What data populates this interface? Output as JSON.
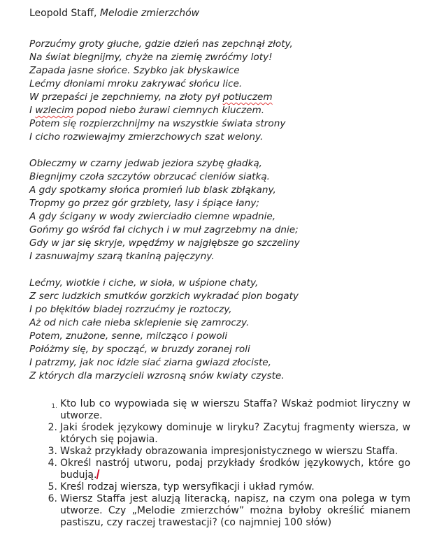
{
  "header": {
    "author": "Leopold Staff,",
    "title": "Melodie zmierzchów"
  },
  "poem": {
    "stanzas": [
      [
        "Porzućmy groty głuche, gdzie dzień nas zepchnął złoty,",
        "Na świat biegnijmy, chyże na ziemię zwróćmy loty!",
        "Zapada jasne słońce. Szybko jak błyskawice",
        "Lećmy dłoniami mroku zakrywać słońcu lice.",
        "W przepaści je zepchniemy, na złoty pył ",
        "I ",
        "Potem się rozpierzchnijmy na wszystkie świata strony",
        "I cicho rozwiewajmy zmierzchowych szat welony."
      ],
      [
        "Obleczmy w czarny jedwab jeziora szybę gładką,",
        "Biegnijmy czoła szczytów obrzucać cieniów siatką.",
        "A gdy spotkamy słońca promień lub blask zbłąkany,",
        "Tropmy go przez gór grzbiety, lasy i śpiące łany;",
        "A gdy ścigany w wody zwierciadło ciemne wpadnie,",
        "Gońmy go wśród fal cichych i w muł zagrzebmy na dnie;",
        "Gdy w jar się skryje, wpędźmy w najgłębsze go szczeliny",
        "I zasnuwajmy szarą tkaniną pajęczyny."
      ],
      [
        "Lećmy, wiotkie i ciche, w sioła, w uśpione chaty,",
        "Z serc ludzkich smutków gorzkich wykradać plon bogaty",
        "I po błękitów bladej rozrzućmy je roztoczy,",
        "Aż od nich całe nieba sklepienie się zamroczy.",
        "Potem, znużone, senne, milcząco i powoli",
        "Połóżmy się, by spocząć, w bruzdy zoranej roli",
        "I patrzmy, jak noc idzie siać ziarna gwiazd złociste,",
        "Z których dla marzycieli wzrosną snów kwiaty czyste."
      ]
    ],
    "squiggle_words": {
      "s1l5": "potłuczem",
      "s1l6_word": "wzlecim",
      "s1l6_rest": " popod niebo żurawi ciemnych kluczem."
    }
  },
  "questions": {
    "numbers": [
      "1.",
      "2.",
      "3.",
      "4.",
      "5.",
      "6."
    ],
    "items": [
      "Kto lub co wypowiada się w wierszu Staffa? Wskaż podmiot liryczny w utworze.",
      "Jaki środek językowy dominuje w liryku? Zacytuj fragmenty wiersza, w których się pojawia.",
      "Wskaż przykłady obrazowania impresjonistycznego w wierszu Staffa.",
      "Kreśl rodzaj wiersza, typ wersyfikacji i układ rymów.",
      "Wiersz Staffa jest aluzją literacką, napisz, na czym ona polega w tym utworze. Czy „Melodie zmierzchów” można byłoby określić mianem pastiszu, czy raczej trawestacji? (co najmniej 100 słów)"
    ],
    "q4_a": "Określ nast",
    "q4_b": "rój utworu, podaj przykłady środków językowych, które go budują."
  }
}
